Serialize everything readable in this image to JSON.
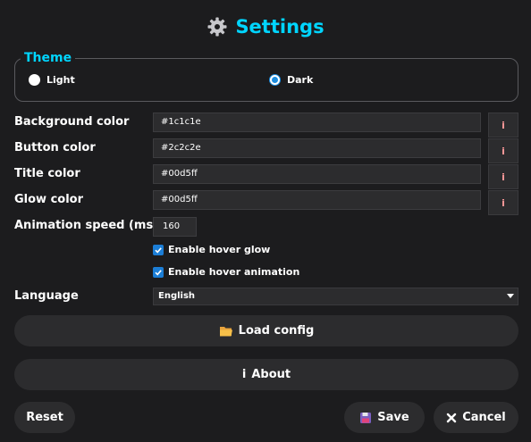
{
  "header": {
    "title": "Settings",
    "icon": "gear-icon"
  },
  "theme": {
    "legend": "Theme",
    "options": [
      {
        "label": "Light",
        "checked": false
      },
      {
        "label": "Dark",
        "checked": true
      }
    ]
  },
  "colors": {
    "title": "#00d5ff",
    "background": "#1c1c1e",
    "panel": "#2c2c2e",
    "check_accent": "#1c7ed6",
    "radio_accent": "#1c8de0",
    "pick_glyph": "#ff9a9a"
  },
  "fields": [
    {
      "label": "Background color",
      "value": "#1c1c1e",
      "picker": "i"
    },
    {
      "label": "Button color",
      "value": "#2c2c2e",
      "picker": "i"
    },
    {
      "label": "Title color",
      "value": "#00d5ff",
      "picker": "i"
    },
    {
      "label": "Glow color",
      "value": "#00d5ff",
      "picker": "i"
    }
  ],
  "animation": {
    "label": "Animation speed (ms)",
    "value": "160"
  },
  "checkboxes": [
    {
      "label": "Enable hover glow",
      "checked": true
    },
    {
      "label": "Enable hover animation",
      "checked": true
    }
  ],
  "language": {
    "label": "Language",
    "value": "English"
  },
  "buttons": {
    "load_config": "Load config",
    "about": "About",
    "about_prefix": "i",
    "reset": "Reset",
    "save": "Save",
    "cancel": "Cancel"
  }
}
